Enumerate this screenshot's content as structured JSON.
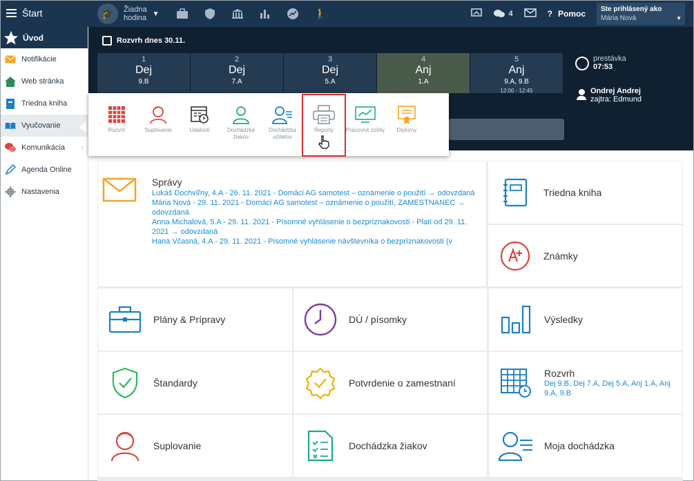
{
  "topbar": {
    "start": "Štart",
    "hodina": [
      "Žiadna",
      "hodina"
    ],
    "messages_count": "4",
    "help": "Pomoc",
    "logged_label": "Ste prihlásený ako",
    "user": "Mária Nová"
  },
  "sidebar": {
    "head": "Úvod",
    "items": [
      {
        "label": "Notifikácie",
        "icon": "envelope-icon",
        "color": "#f5a623"
      },
      {
        "label": "Web stránka",
        "icon": "house-icon",
        "color": "#2e8b57"
      },
      {
        "label": "Triedna kniha",
        "icon": "book-icon",
        "color": "#1b7fc4"
      },
      {
        "label": "Vyučovanie",
        "icon": "open-book-icon",
        "color": "#1b7fc4"
      },
      {
        "label": "Komunikácia",
        "icon": "chat-icon",
        "color": "#d9453b"
      },
      {
        "label": "Agenda Online",
        "icon": "pen-icon",
        "color": "#1b7fc4"
      },
      {
        "label": "Nastavenia",
        "icon": "gear-icon",
        "color": "#8a959e"
      }
    ]
  },
  "hero": {
    "title": "Rozvrh dnes 30.11.",
    "lessons": [
      {
        "n": "1",
        "s": "Dej",
        "c": "9.B",
        "t": ""
      },
      {
        "n": "2",
        "s": "Dej",
        "c": "7.A",
        "t": ""
      },
      {
        "n": "3",
        "s": "Dej",
        "c": "5.A",
        "t": ""
      },
      {
        "n": "4",
        "s": "Anj",
        "c": "1.A",
        "t": ""
      },
      {
        "n": "5",
        "s": "Anj",
        "c": "9.A, 9.B",
        "t": "12:00 - 12:45"
      }
    ],
    "break_label": "prestávka",
    "break_time": "07:53",
    "teacher": "Ondrej Andrej",
    "tomorrow": "zajtra: Edmund"
  },
  "popup": {
    "items": [
      "Rozvrh",
      "Suplovanie",
      "Udalosti",
      "Dochádzka žiakov",
      "Dochádzka učiteľov",
      "Reporty",
      "Pracovné zošity",
      "Diplomy"
    ]
  },
  "cards": {
    "spravy": {
      "title": "Správy",
      "messages": [
        "Lukáš Dochvíľny, 4.A - 26. 11. 2021 - Domáci AG samotest – oznámenie o použití → odovzdaná",
        "Mária Nová - 29. 11. 2021 - Domáci AG samotest – oznámenie o použití, ZAMESTNANEC → odovzdaná",
        "Anna Michalová, 5.A - 29. 11. 2021 - Písomné vyhlásenie o bezpríznakovosti - Platí od 29. 11. 2021 → odovzdaná",
        "Hana Včasná, 4.A - 29. 11. 2021 - Písomné vyhlásenie návštevníka o bezpríznakovosti (v"
      ]
    },
    "triedna": "Triedna kniha",
    "znamky": "Známky",
    "plany": "Plány & Prípravy",
    "du": "DÚ / písomky",
    "vysledky": "Výsledky",
    "standardy": "Štandardy",
    "potvrdenie": "Potvrdenie o zamestnaní",
    "rozvrh": "Rozvrh",
    "rozvrh_sub": "Dej 9.B, Dej 7.A, Dej 5.A, Anj 1.A, Anj 9.A, 9.B",
    "suplovanie": "Suplovanie",
    "dochadzka": "Dochádzka žiakov",
    "moja": "Moja dochádzka"
  }
}
